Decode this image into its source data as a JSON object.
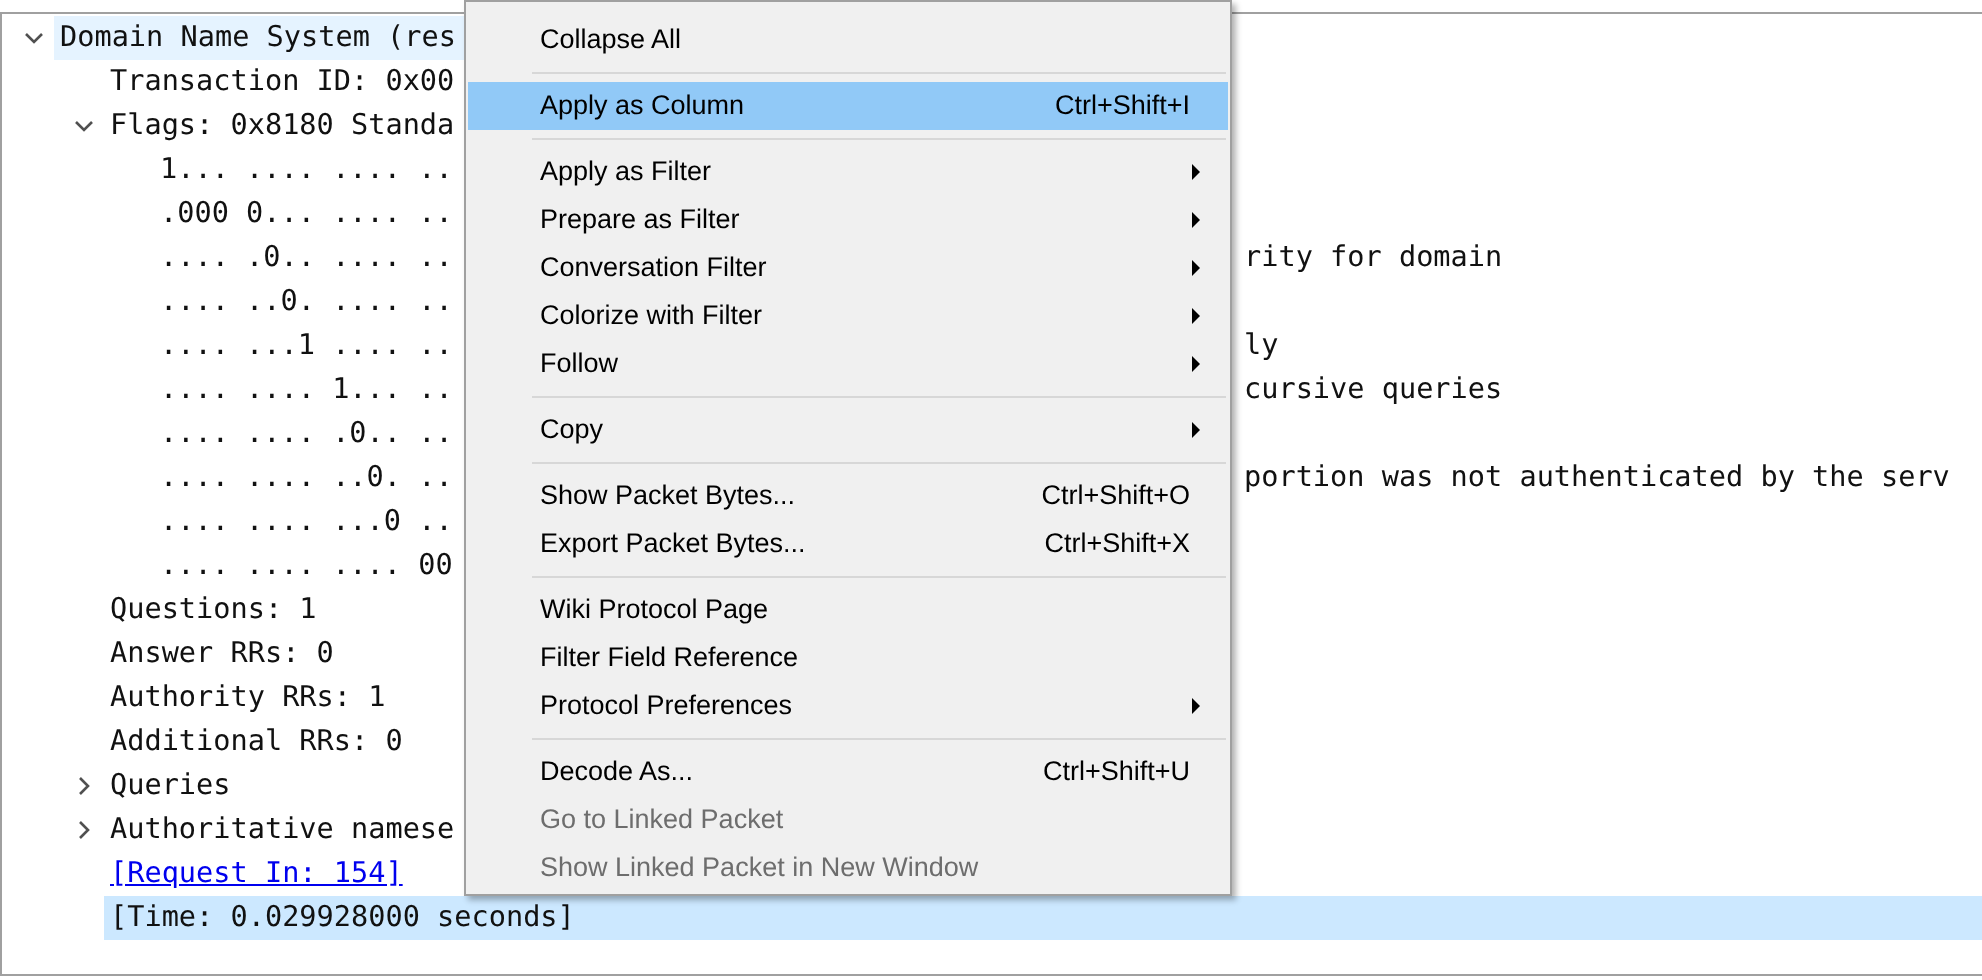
{
  "tree": [
    {
      "text": "Domain Name System (res",
      "expanded": true,
      "selected": false,
      "hovered": true,
      "children": [
        {
          "text": "Transaction ID: 0x00",
          "selected": false,
          "hovered": false
        },
        {
          "text": "Flags: 0x8180 Standa",
          "expanded": true,
          "selected": false,
          "hovered": false,
          "children": [
            {
              "text": "1... .... .... ..",
              "selected": false,
              "hovered": false
            },
            {
              "text": ".000 0... .... ..",
              "selected": false,
              "hovered": false
            },
            {
              "text": ".... .0.. .... ..",
              "text_right": "rity for domain",
              "selected": false,
              "hovered": false
            },
            {
              "text": ".... ..0. .... ..",
              "selected": false,
              "hovered": false
            },
            {
              "text": ".... ...1 .... ..",
              "text_right": "ly",
              "selected": false,
              "hovered": false
            },
            {
              "text": ".... .... 1... ..",
              "text_right": "cursive queries",
              "selected": false,
              "hovered": false
            },
            {
              "text": ".... .... .0.. ..",
              "selected": false,
              "hovered": false
            },
            {
              "text": ".... .... ..0. ..",
              "text_right": "portion was not authenticated by the serv",
              "selected": false,
              "hovered": false
            },
            {
              "text": ".... .... ...0 ..",
              "selected": false,
              "hovered": false
            },
            {
              "text": ".... .... .... 00",
              "selected": false,
              "hovered": false
            }
          ]
        },
        {
          "text": "Questions: 1",
          "selected": false,
          "hovered": false
        },
        {
          "text": "Answer RRs: 0",
          "selected": false,
          "hovered": false
        },
        {
          "text": "Authority RRs: 1",
          "selected": false,
          "hovered": false
        },
        {
          "text": "Additional RRs: 0",
          "selected": false,
          "hovered": false
        },
        {
          "text": "Queries",
          "expanded": false,
          "selected": false,
          "hovered": false
        },
        {
          "text": "Authoritative namese",
          "expanded": false,
          "selected": false,
          "hovered": false
        },
        {
          "text": "[Request In: 154]",
          "kind": "link",
          "selected": false,
          "hovered": false
        },
        {
          "text": "[Time: 0.029928000 seconds]",
          "selected": true,
          "hovered": false
        }
      ]
    }
  ],
  "context_menu": [
    {
      "kind": "item",
      "label": "Collapse All",
      "highlighted": false,
      "disabled": false
    },
    {
      "kind": "separator"
    },
    {
      "kind": "item",
      "label": "Apply as Column",
      "shortcut": "Ctrl+Shift+I",
      "highlighted": true,
      "disabled": false
    },
    {
      "kind": "separator"
    },
    {
      "kind": "item",
      "label": "Apply as Filter",
      "submenu": true,
      "highlighted": false,
      "disabled": false
    },
    {
      "kind": "item",
      "label": "Prepare as Filter",
      "submenu": true,
      "highlighted": false,
      "disabled": false
    },
    {
      "kind": "item",
      "label": "Conversation Filter",
      "submenu": true,
      "highlighted": false,
      "disabled": false
    },
    {
      "kind": "item",
      "label": "Colorize with Filter",
      "submenu": true,
      "highlighted": false,
      "disabled": false
    },
    {
      "kind": "item",
      "label": "Follow",
      "submenu": true,
      "highlighted": false,
      "disabled": false
    },
    {
      "kind": "separator"
    },
    {
      "kind": "item",
      "label": "Copy",
      "submenu": true,
      "highlighted": false,
      "disabled": false
    },
    {
      "kind": "separator"
    },
    {
      "kind": "item",
      "label": "Show Packet Bytes...",
      "shortcut": "Ctrl+Shift+O",
      "highlighted": false,
      "disabled": false
    },
    {
      "kind": "item",
      "label": "Export Packet Bytes...",
      "shortcut": "Ctrl+Shift+X",
      "highlighted": false,
      "disabled": false
    },
    {
      "kind": "separator"
    },
    {
      "kind": "item",
      "label": "Wiki Protocol Page",
      "highlighted": false,
      "disabled": false
    },
    {
      "kind": "item",
      "label": "Filter Field Reference",
      "highlighted": false,
      "disabled": false
    },
    {
      "kind": "item",
      "label": "Protocol Preferences",
      "submenu": true,
      "highlighted": false,
      "disabled": false
    },
    {
      "kind": "separator"
    },
    {
      "kind": "item",
      "label": "Decode As...",
      "shortcut": "Ctrl+Shift+U",
      "highlighted": false,
      "disabled": false
    },
    {
      "kind": "item",
      "label": "Go to Linked Packet",
      "highlighted": false,
      "disabled": true
    },
    {
      "kind": "item",
      "label": "Show Linked Packet in New Window",
      "highlighted": false,
      "disabled": true
    }
  ]
}
